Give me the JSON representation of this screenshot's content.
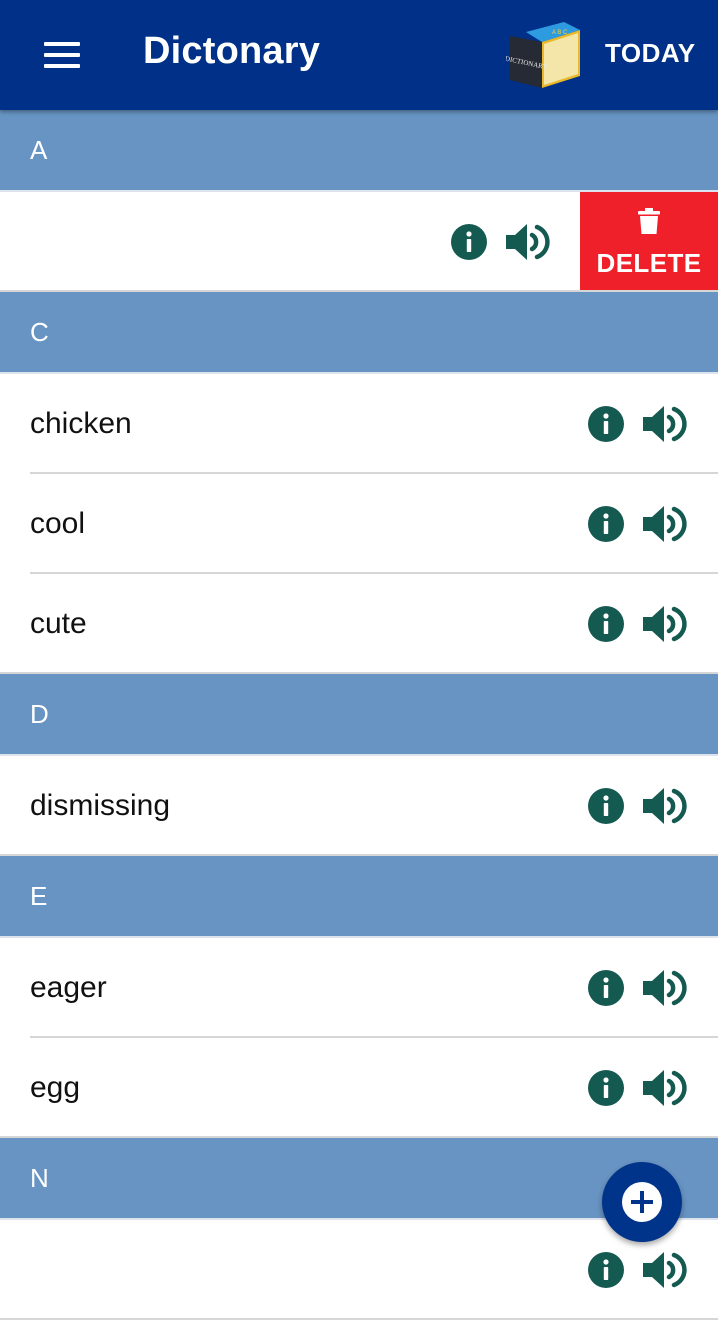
{
  "appbar": {
    "title": "Dictonary",
    "logo_text": "DICTIONARY",
    "logo_letters": "A B C",
    "today_label": "TODAY",
    "color": "#003087"
  },
  "colors": {
    "section_header": "#6894c3",
    "icon": "#155a50",
    "delete": "#f0202b"
  },
  "sections": [
    {
      "letter": "A",
      "rows": [
        {
          "word": "",
          "swiped": true
        }
      ]
    },
    {
      "letter": "C",
      "rows": [
        {
          "word": "chicken"
        },
        {
          "word": "cool"
        },
        {
          "word": "cute"
        }
      ]
    },
    {
      "letter": "D",
      "rows": [
        {
          "word": "dismissing"
        }
      ]
    },
    {
      "letter": "E",
      "rows": [
        {
          "word": "eager"
        },
        {
          "word": "egg"
        }
      ]
    },
    {
      "letter": "N",
      "rows": [
        {
          "word": ""
        }
      ]
    }
  ],
  "row_actions": {
    "info_icon": "info-icon",
    "speaker_icon": "speaker-icon",
    "delete_label": "DELETE",
    "delete_icon": "trash-icon"
  },
  "fab": {
    "icon": "add-circle-icon"
  }
}
